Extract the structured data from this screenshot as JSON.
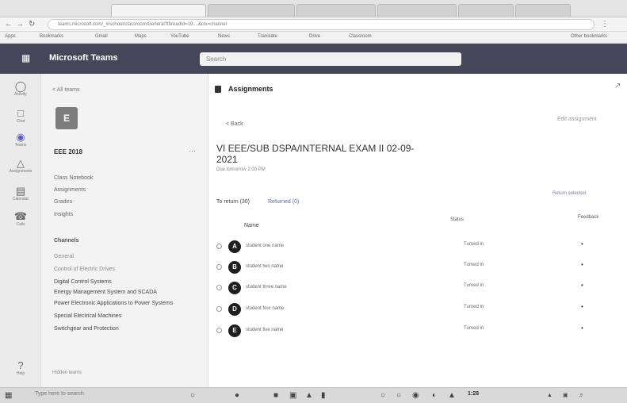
{
  "browser": {
    "tabs": [
      "",
      "",
      "",
      "",
      "",
      ""
    ],
    "url": "teams.microsoft.com/_#/school/classroom/General?threadId=19:...&ctx=channel",
    "bookmarks": [
      "Apps",
      "Bookmarks",
      "Gmail",
      "Maps",
      "YouTube",
      "News",
      "Translate",
      "Drive",
      "Classroom",
      "Other bookmarks"
    ]
  },
  "teams": {
    "app_title": "Microsoft Teams",
    "search_placeholder": "Search"
  },
  "appbar": {
    "items": [
      {
        "icon": "bell-icon",
        "label": "Activity"
      },
      {
        "icon": "chat-icon",
        "label": "Chat"
      },
      {
        "icon": "teams-icon",
        "label": "Teams"
      },
      {
        "icon": "assignments-icon",
        "label": "Assignments"
      },
      {
        "icon": "calendar-icon",
        "label": "Calendar"
      },
      {
        "icon": "calls-icon",
        "label": "Calls"
      },
      {
        "icon": "help-icon",
        "label": "Help"
      }
    ]
  },
  "team_panel": {
    "back_label": "< All teams",
    "avatar_initials": "E",
    "team_name": "EEE 2018",
    "nav": [
      "Class Notebook",
      "Assignments",
      "Grades",
      "Insights"
    ],
    "channels_header": "Channels",
    "channels": [
      {
        "label": "General",
        "faint": true
      },
      {
        "label": "Control of Electric Drives",
        "faint": true
      },
      {
        "label": "Digital Control Systems",
        "faint": false
      },
      {
        "label": "Energy Management System and SCADA",
        "faint": false
      },
      {
        "label": "Power Electronic Applications to Power Systems",
        "faint": false
      },
      {
        "label": "Special Electrical Machines",
        "faint": false
      },
      {
        "label": "Switchgear and Protection",
        "faint": false
      }
    ],
    "hidden_teams": "Hidden teams"
  },
  "main": {
    "header_title": "Assignments",
    "sub_nav": "< Back",
    "edit_label": "Edit assignment",
    "exam_title": "VI EEE/SUB DSPA/INTERNAL EXAM II 02-09-2021",
    "due": "Due tomorrow 2:00 PM",
    "tab_to_return": "To return (30)",
    "tab_returned": "Returned (0)",
    "review_link": "Return selected",
    "col_name": "Name",
    "col_status": "Status",
    "col_feedback": "Feedback",
    "rows": [
      {
        "initial": "A",
        "name": "student one name",
        "status": "Turned in",
        "feedback": "•"
      },
      {
        "initial": "B",
        "name": "student two name",
        "status": "Turned in",
        "feedback": "•"
      },
      {
        "initial": "C",
        "name": "student three name",
        "status": "Turned in",
        "feedback": "•"
      },
      {
        "initial": "D",
        "name": "student four name",
        "status": "Turned in",
        "feedback": "•"
      },
      {
        "initial": "E",
        "name": "student five name",
        "status": "Turned in",
        "feedback": "•"
      }
    ]
  },
  "taskbar": {
    "search": "Type here to search",
    "clock": "1:28"
  }
}
